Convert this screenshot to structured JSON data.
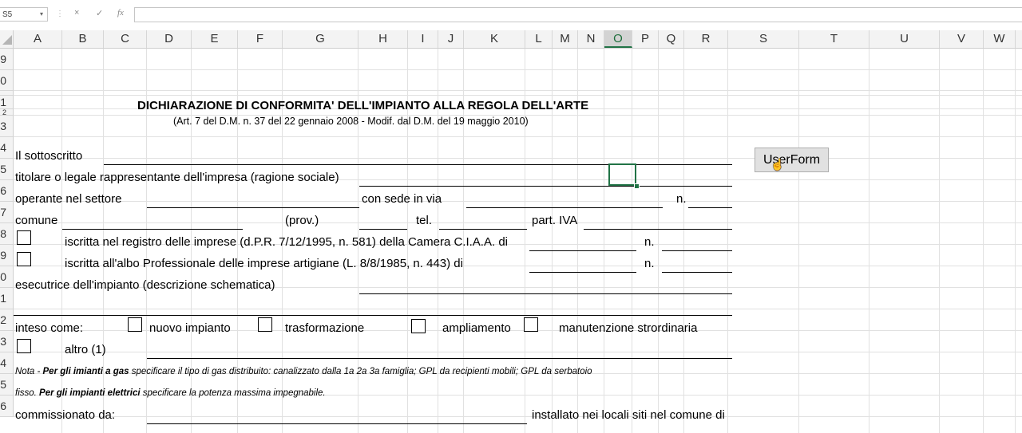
{
  "formula_bar": {
    "name_box": "S5",
    "cancel_icon": "×",
    "enter_icon": "✓",
    "fx_label": "fx",
    "formula": ""
  },
  "columns": [
    "A",
    "B",
    "C",
    "D",
    "E",
    "F",
    "G",
    "H",
    "I",
    "J",
    "K",
    "L",
    "M",
    "N",
    "O",
    "P",
    "Q",
    "R",
    "S",
    "T",
    "U",
    "V",
    "W"
  ],
  "active_column": "O",
  "rows": [
    "9",
    "0",
    "",
    "1",
    "2",
    "3",
    "4",
    "5",
    "6",
    "7",
    "8",
    "9",
    "0",
    "1",
    "2",
    "3",
    "4",
    "5",
    "6"
  ],
  "active_row": "5",
  "form": {
    "title": "DICHIARAZIONE DI CONFORMITA' DELL'IMPIANTO ALLA REGOLA DELL'ARTE",
    "subtitle": "(Art. 7 del D.M. n. 37 del 22 gennaio 2008 - Modif. dal D.M. del 19 maggio 2010)",
    "sottoscritto": "Il sottoscritto",
    "titolare": "titolare o legale rappresentante dell'impresa (ragione sociale)",
    "operante": "operante nel settore",
    "con_sede": "con  sede in via",
    "n": "n.",
    "comune": "comune",
    "prov": "(prov.)",
    "tel": "tel.",
    "part_iva": "part. IVA",
    "registro": "iscritta nel registro delle imprese (d.P.R. 7/12/1995, n. 581) della Camera C.I.A.A. di",
    "albo": "iscritta all'albo Professionale delle imprese artigiane (L. 8/8/1985, n. 443) di",
    "esecutrice": "esecutrice dell'impianto (descrizione schematica)",
    "inteso_come": "inteso come:",
    "nuovo_impianto": "nuovo impianto",
    "trasformazione": "trasformazione",
    "ampliamento": "ampliamento",
    "manutenzione": "manutenzione strordinaria",
    "altro": "altro (1)",
    "nota_prefix": "Nota - ",
    "nota_bold": "Per gli imianti a gas",
    "nota_rest": " specificare il tipo di gas distribuito: canalizzato dalla 1a 2a 3a famiglia; GPL da recipienti mobili; GPL da serbatoio",
    "fisso_prefix": "fisso.  ",
    "fisso_bold": "Per gli impianti elettrici",
    "fisso_rest": " specificare la potenza massima impegnabile.",
    "commissionato": "commissionato da:",
    "installato": "installato nei locali siti nel comune di"
  },
  "userform_button": "UserForm"
}
